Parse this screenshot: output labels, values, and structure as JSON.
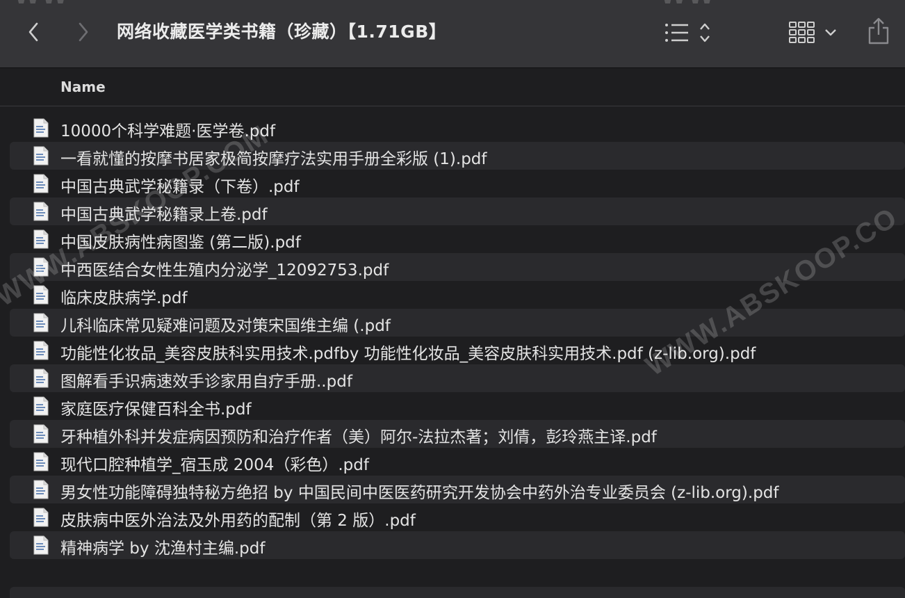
{
  "toolbar": {
    "title": "网络收藏医学类书籍（珍藏）【1.71GB】",
    "back_icon": "chevron-left-icon",
    "forward_icon": "chevron-right-icon",
    "list_icon": "list-sort-icon",
    "grid_icon": "grid-view-icon",
    "share_icon": "share-icon"
  },
  "header": {
    "name_column": "Name"
  },
  "files": [
    "10000个科学难题·医学卷.pdf",
    "一看就懂的按摩书居家极简按摩疗法实用手册全彩版 (1).pdf",
    "中国古典武学秘籍录（下卷）.pdf",
    "中国古典武学秘籍录上卷.pdf",
    "中国皮肤病性病图鉴 (第二版).pdf",
    "中西医结合女性生殖内分泌学_12092753.pdf",
    "临床皮肤病学.pdf",
    "儿科临床常见疑难问题及对策宋国维主编 (.pdf",
    "功能性化妆品_美容皮肤科实用技术.pdfby 功能性化妆品_美容皮肤科实用技术.pdf (z-lib.org).pdf",
    "图解看手识病速效手诊家用自疗手册..pdf",
    "家庭医疗保健百科全书.pdf",
    "牙种植外科并发症病因预防和治疗作者（美）阿尔-法拉杰著；刘倩，彭玲燕主译.pdf",
    "现代口腔种植学_宿玉成 2004（彩色）.pdf",
    "男女性功能障碍独特秘方绝招 by 中国民间中医医药研究开发协会中药外治专业委员会 (z-lib.org).pdf",
    "皮肤病中医外治法及外用药的配制（第 2 版）.pdf",
    "精神病学 by 沈渔村主编.pdf"
  ],
  "watermarks": {
    "text_1": "WWW.ABSKOOP.COM",
    "text_2": "WWW.ABSKOOP.CO",
    "text_top_1": "WW",
    "text_top_2": "WW"
  },
  "colors": {
    "toolbar_bg": "#353538",
    "list_bg": "#1e1e20",
    "alt_row_bg": "#2a2a2d",
    "text": "#e4e4e4"
  }
}
